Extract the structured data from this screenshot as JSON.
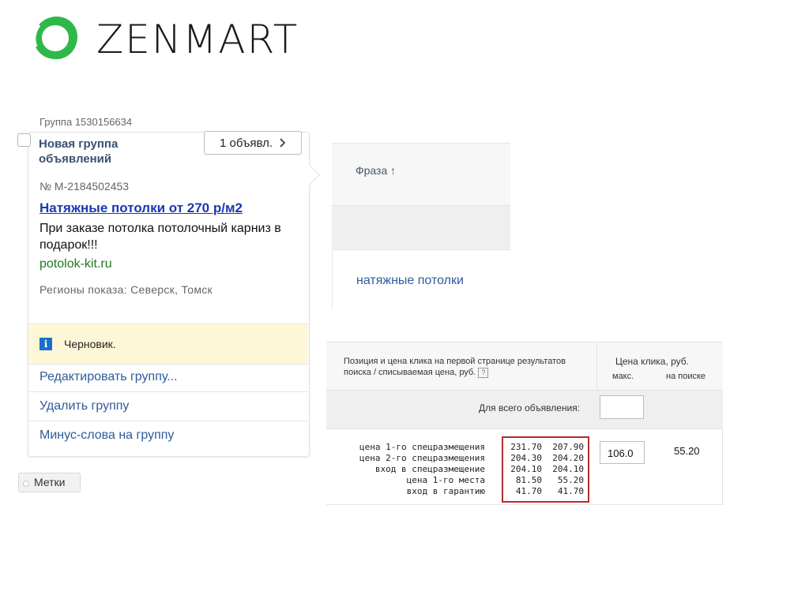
{
  "logo": {
    "text": "ZENMART",
    "color": "#2fb84a",
    "icon": "zenmart-ring-logo"
  },
  "group": {
    "id_label": "Группа 1530156634",
    "name": "Новая группа объявлений",
    "ads_button": "1 объявл.",
    "ad_number": "№ M-2184502453",
    "ad_title": "Натяжные потолки от 270 р/м2",
    "ad_text": "При заказе потолка потолочный карниз в подарок!!!",
    "ad_url": "potolok-kit.ru",
    "regions": "Регионы показа: Северск, Томск",
    "status": "Черновик.",
    "menu": [
      "Редактировать группу...",
      "Удалить группу",
      "Минус-слова на группу"
    ]
  },
  "labels_button": "Метки",
  "phrases": {
    "header": "Фраза ↑",
    "item": "натяжные потолки"
  },
  "price": {
    "header_text": "Позиция и цена клика на первой странице результатов поиска / списываемая цена, руб.",
    "help_icon": "?",
    "click_price_title": "Цена клика, руб.",
    "col_max": "макс.",
    "col_search": "на поиске",
    "for_all_label": "Для всего объявления:",
    "positions": [
      {
        "label": "цена 1-го спецразмещения",
        "v1": "231.70",
        "v2": "207.90"
      },
      {
        "label": "цена 2-го спецразмещения",
        "v1": "204.30",
        "v2": "204.20"
      },
      {
        "label": "вход в спецразмещение",
        "v1": "204.10",
        "v2": "204.10"
      },
      {
        "label": "цена 1-го места",
        "v1": "81.50",
        "v2": "55.20"
      },
      {
        "label": "вход в гарантию",
        "v1": "41.70",
        "v2": "41.70"
      }
    ],
    "max_value": "106.0",
    "search_value": "55.20"
  }
}
